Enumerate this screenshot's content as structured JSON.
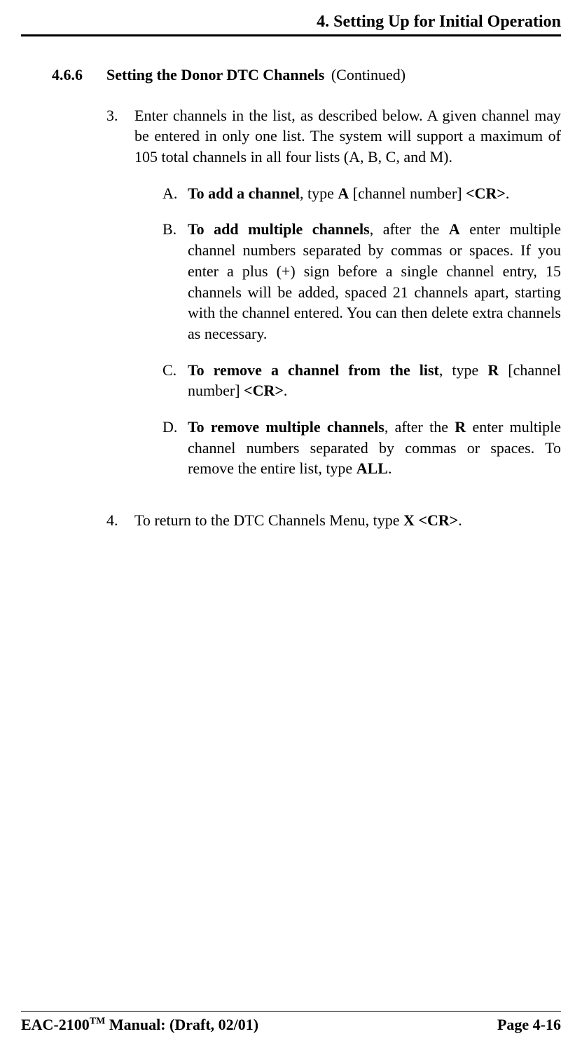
{
  "header": {
    "chapter": "4. Setting Up for Initial Operation"
  },
  "section": {
    "number": "4.6.6",
    "title": "Setting the Donor DTC Channels",
    "suffix": "(Continued)"
  },
  "step3": {
    "marker": "3.",
    "intro": "Enter channels in the list, as described below. A given channel may be entered in only one list. The system will support a maximum of 105 total channels in all four lists (A, B, C, and M).",
    "A": {
      "marker": "A.",
      "lead": "To add a channel",
      "mid": ", type ",
      "key": "A",
      "tail": " [channel number] ",
      "end": "<CR>",
      "dot": "."
    },
    "B": {
      "marker": "B.",
      "lead": "To add multiple channels",
      "mid1": ", after the ",
      "key": "A",
      "rest": " enter multiple channel numbers separated by commas or spaces. If you enter a plus (+) sign before a single channel entry, 15 channels will be added, spaced 21 channels apart, starting with the channel entered. You can then delete extra channels as necessary."
    },
    "C": {
      "marker": "C.",
      "lead": "To remove a channel from the list",
      "mid": ", type ",
      "key": "R",
      "tail": " [channel number] ",
      "end": "<CR>",
      "dot": "."
    },
    "D": {
      "marker": "D.",
      "lead": "To remove multiple channels",
      "mid1": ", after the ",
      "key": "R",
      "mid2": " enter multiple channel numbers separated by commas or spaces. To remove the entire list, type ",
      "all": "ALL",
      "dot": "."
    }
  },
  "step4": {
    "marker": "4.",
    "pre": "To return to the DTC Channels Menu, type ",
    "key": "X <CR>",
    "dot": "."
  },
  "footer": {
    "left_pre": "EAC-2100",
    "left_tm": "TM",
    "left_post": " Manual: (Draft, 02/01)",
    "right": "Page 4-16"
  }
}
